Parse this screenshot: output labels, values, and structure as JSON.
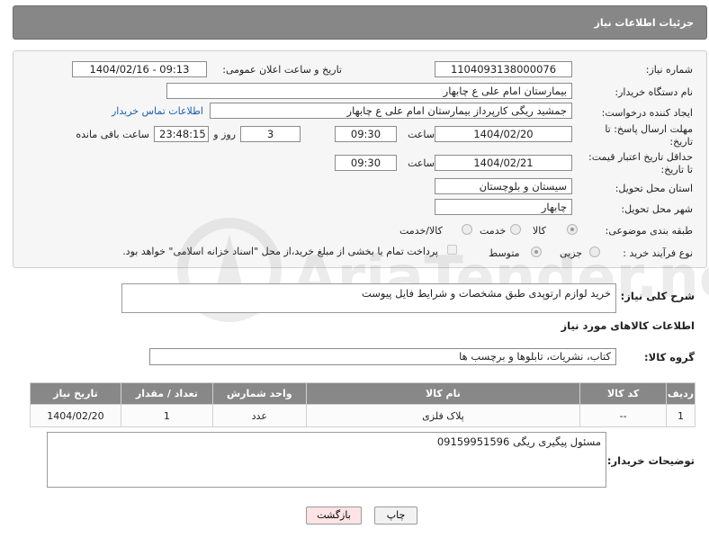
{
  "header": {
    "title": "جزئیات اطلاعات نیاز"
  },
  "form": {
    "need_number_label": "شماره نیاز:",
    "need_number": "1104093138000076",
    "announce_label": "تاریخ و ساعت اعلان عمومی:",
    "announce_value": "1404/02/16 - 09:13",
    "buyer_org_label": "نام دستگاه خریدار:",
    "buyer_org": "بیمارستان امام علی  ع  چابهار",
    "creator_label": "ایجاد کننده درخواست:",
    "creator": "جمشید ریگی کارپرداز بیمارستان امام علی  ع  چابهار",
    "contact_link": "اطلاعات تماس خریدار",
    "reply_deadline_label_1": "مهلت ارسال پاسخ: تا",
    "reply_deadline_label_2": "تاریخ:",
    "reply_date": "1404/02/20",
    "time_label": "ساعت",
    "reply_time": "09:30",
    "days_value": "3",
    "days_label": "روز و",
    "remaining_time": "23:48:15",
    "remaining_label": "ساعت باقی مانده",
    "price_deadline_label_1": "حداقل تاریخ اعتبار قیمت:",
    "price_deadline_label_2": "تا تاریخ:",
    "price_date": "1404/02/21",
    "price_time": "09:30",
    "province_label": "استان محل تحویل:",
    "province": "سیستان و بلوچستان",
    "city_label": "شهر محل تحویل:",
    "city": "چابهار",
    "category_label": "طبقه بندی موضوعی:",
    "category_options": [
      "کالا",
      "خدمت",
      "کالا/خدمت"
    ],
    "process_label": "نوع فرآیند خرید :",
    "process_options": [
      "جزیی",
      "متوسط"
    ],
    "payment_note": "پرداخت تمام یا بخشی از مبلغ خرید،از محل \"اسناد خزانه اسلامی\" خواهد بود."
  },
  "description": {
    "label": "شرح کلی نیاز:",
    "text": "خرید لوازم ارتوپدی طبق مشخصات و شرایط فایل پیوست"
  },
  "goods_section": {
    "title": "اطلاعات کالاهای مورد نیاز",
    "group_label": "گروه کالا:",
    "group_value": "کتاب، نشریات، تابلوها و برچسب ها",
    "columns": [
      "ردیف",
      "کد کالا",
      "نام کالا",
      "واحد شمارش",
      "تعداد / مقدار",
      "تاریخ نیاز"
    ],
    "rows": [
      {
        "row": "1",
        "code": "--",
        "name": "پلاک فلزی",
        "unit": "عدد",
        "qty": "1",
        "date": "1404/02/20"
      }
    ]
  },
  "buyer_notes": {
    "label": "توضیحات خریدار:",
    "text": "مسئول پیگیری ریگی 09159951596"
  },
  "buttons": {
    "print": "چاپ",
    "back": "بازگشت"
  },
  "colors": {
    "header_bg": "#878787",
    "link": "#1a5fb4",
    "back_button_bg": "#fde3e3"
  }
}
